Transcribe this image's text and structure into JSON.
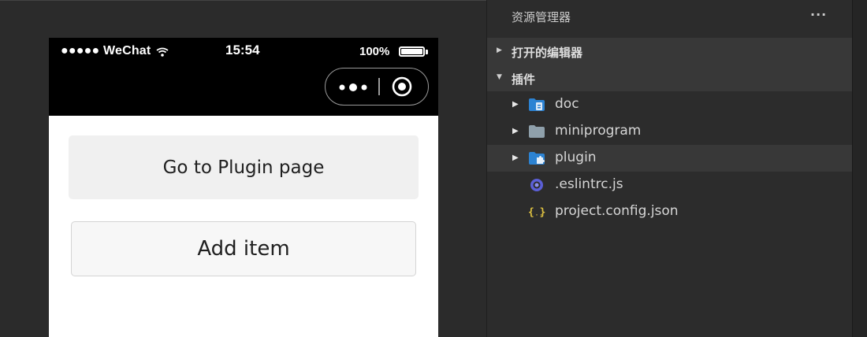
{
  "simulator": {
    "status_bar": {
      "carrier": "●●●●● WeChat",
      "time": "15:54",
      "battery": "100%"
    },
    "buttons": {
      "go_plugin": "Go to Plugin page",
      "add_item": "Add item"
    }
  },
  "explorer": {
    "title": "资源管理器",
    "more_label": "···",
    "sections": {
      "open_editors": "打开的编辑器",
      "plugin_root": "插件"
    },
    "items": [
      {
        "label": "doc",
        "icon": "folder-doc-icon",
        "expandable": true
      },
      {
        "label": "miniprogram",
        "icon": "folder-icon",
        "expandable": true
      },
      {
        "label": "plugin",
        "icon": "folder-plugin-icon",
        "expandable": true,
        "selected": true
      },
      {
        "label": ".eslintrc.js",
        "icon": "eslint-icon",
        "expandable": false
      },
      {
        "label": "project.config.json",
        "icon": "json-icon",
        "expandable": false
      }
    ]
  },
  "colors": {
    "explorer_bg": "#2c2c2c",
    "selection_bg": "#383838",
    "folder_blue": "#2c83d3",
    "folder_gray": "#8fa0ab",
    "json_yellow": "#e0c341",
    "eslint_purple": "#5b5fd6"
  }
}
